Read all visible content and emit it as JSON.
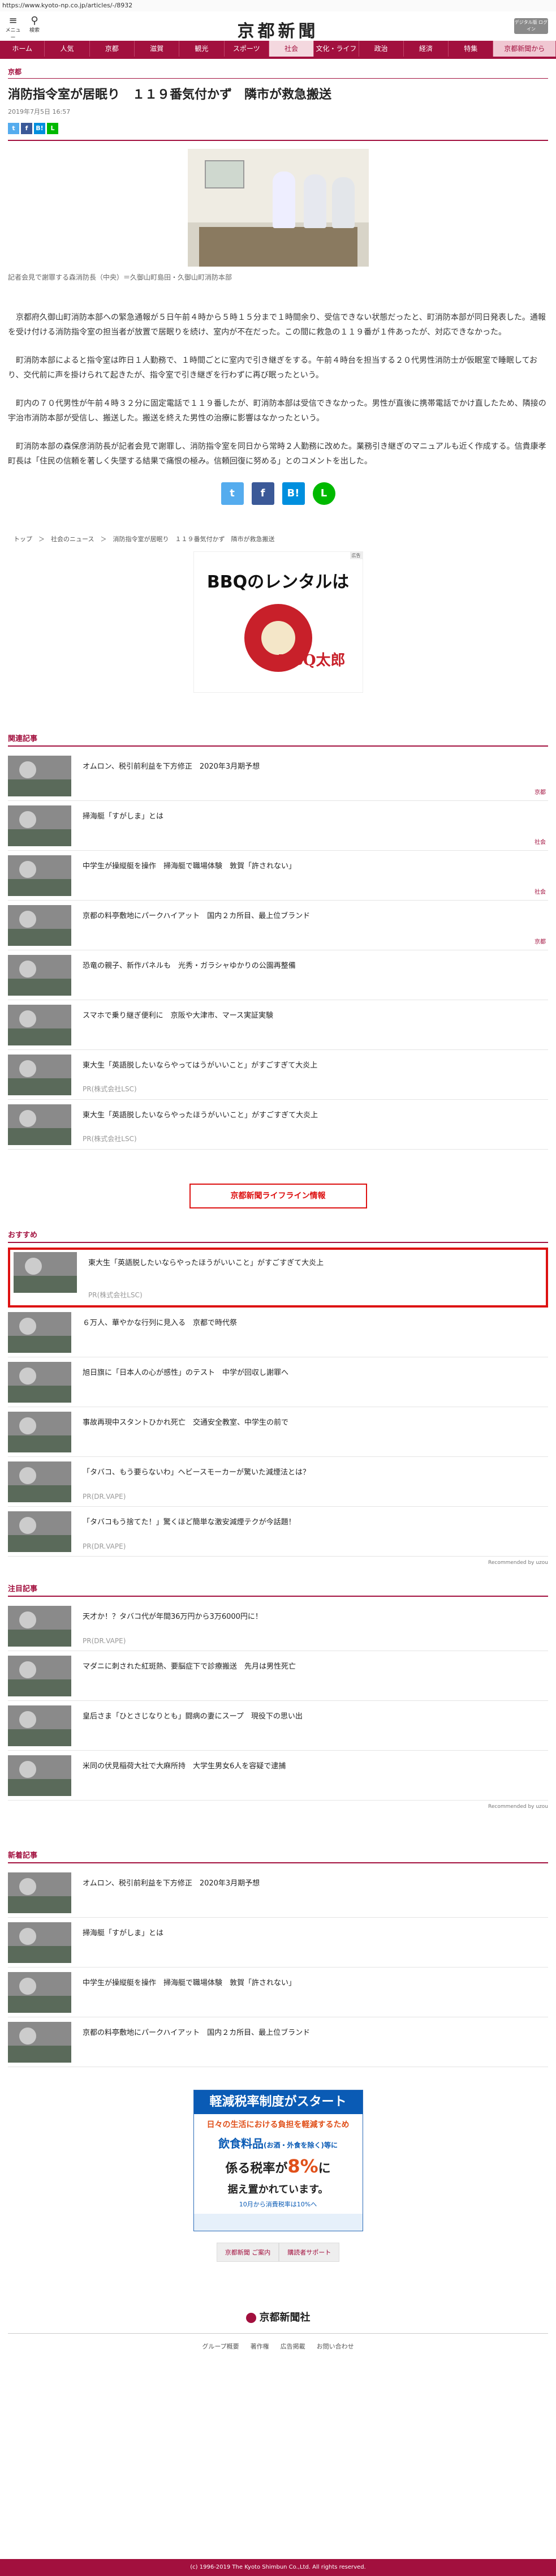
{
  "url": "https://www.kyoto-np.co.jp/articles/-/8932",
  "header": {
    "menu_icon": "≡",
    "menu_label": "メニュー",
    "search_icon": "⚲",
    "search_label": "検索",
    "logo": "京都新聞",
    "digital_label": "デジタル版 ログイン"
  },
  "nav": [
    "ホーム",
    "人気",
    "京都",
    "滋賀",
    "観光",
    "スポーツ",
    "社会",
    "文化・ライフ",
    "政治",
    "経済",
    "特集",
    "京都新聞から"
  ],
  "article": {
    "category": "京都",
    "title": "消防指令室が居眠り　１１９番気付かず　隣市が救急搬送",
    "date": "2019年7月5日 16:57",
    "share_small": [
      "t",
      "f",
      "B!",
      "L"
    ],
    "caption": "記者会見で謝罪する森消防長（中央）＝久御山町島田・久御山町消防本部",
    "paragraphs": [
      "京都府久御山町消防本部への緊急通報が５日午前４時から５時１５分まで１時間余り、受信できない状態だったと、町消防本部が同日発表した。通報を受け付ける消防指令室の担当者が放置で居眠りを続け、室内が不在だった。この間に救急の１１９番が１件あったが、対応できなかった。",
      "町消防本部によると指令室は昨日１人勤務で、１時間ごとに室内で引き継ぎをする。午前４時台を担当する２０代男性消防士が仮眠室で睡眠しており、交代前に声を掛けられて起きたが、指令室で引き継ぎを行わずに再び眠ったという。",
      "町内の７０代男性が午前４時３２分に固定電話で１１９番したが、町消防本部は受信できなかった。男性が直後に携帯電話でかけ直したため、隣接の宇治市消防本部が受信し、搬送した。搬送を終えた男性の治療に影響はなかったという。",
      "町消防本部の森保彦消防長が記者会見で謝罪し、消防指令室を同日から常時２人勤務に改めた。業務引き継ぎのマニュアルも近く作成する。信貴康孝町長は「住民の信頼を著しく失墜する結果で痛恨の極み。信頼回復に努める」とのコメントを出した。"
    ],
    "share_big": [
      "t",
      "f",
      "B!",
      "L"
    ],
    "breadcrumb": "トップ　＞　社会のニュース　＞　消防指令室が居眠り　１１９番気付かず　隣市が救急搬送"
  },
  "ad1": {
    "tag": "広告",
    "headline": "BBQのレンタルは",
    "brand": "BBQ太郎"
  },
  "related": {
    "title": "関連記事",
    "items": [
      {
        "title": "オムロン、税引前利益を下方修正　2020年3月期予想",
        "source": "",
        "tag": "京都"
      },
      {
        "title": "掃海艇「すがしま」とは",
        "source": "",
        "tag": "社会"
      },
      {
        "title": "中学生が操縦艇を操作　掃海艇で職場体験　敦賀「許されない」",
        "source": "",
        "tag": "社会"
      },
      {
        "title": "京都の料亭敷地にパークハイアット　国内２カ所目、最上位ブランド",
        "source": "",
        "tag": "京都"
      },
      {
        "title": "恐竜の親子、新作パネルも　光秀・ガラシャゆかりの公園再整備",
        "source": "",
        "tag": ""
      },
      {
        "title": "スマホで乗り継ぎ便利に　京阪や大津市、マース実証実験",
        "source": "",
        "tag": ""
      },
      {
        "title": "東大生「英語脱したいならやってはうがいいこと」がすごすぎて大炎上",
        "source": "PR(株式会社LSC)",
        "tag": ""
      },
      {
        "title": "東大生「英語脱したいならやったほうがいいこと」がすごすぎて大炎上",
        "source": "PR(株式会社LSC)",
        "tag": ""
      }
    ],
    "lifeline": "京都新聞ライフライン情報"
  },
  "recommended": {
    "title": "おすすめ",
    "items": [
      {
        "title": "東大生「英語脱したいならやったほうがいいこと」がすごすぎて大炎上",
        "source": "PR(株式会社LSC)"
      },
      {
        "title": "６万人、華やかな行列に見入る　京都で時代祭",
        "source": ""
      },
      {
        "title": "旭日旗に「日本人の心が感性」のテスト　中学が回収し謝罪へ",
        "source": ""
      },
      {
        "title": "事故再現中スタントひかれ死亡　交通安全教室、中学生の前で",
        "source": ""
      },
      {
        "title": "「タバコ、もう要らないわ」ヘビースモーカーが驚いた減煙法とは？",
        "source": "PR(DR.VAPE)"
      },
      {
        "title": "「タバコもう捨てた！」驚くほど簡単な激安減煙テクが今話題！",
        "source": "PR(DR.VAPE)"
      }
    ],
    "footer": "Recommended by uzou"
  },
  "featured": {
    "title": "注目記事",
    "items": [
      {
        "title": "天才か！？タバコ代が年間36万円から3万6000円に！",
        "source": "PR(DR.VAPE)"
      },
      {
        "title": "マダニに刺された紅斑熱、要脳症下で診療搬送　先月は男性死亡",
        "source": ""
      },
      {
        "title": "皇后さま「ひとさじなりとも」闘病の妻にスープ　現役下の思い出",
        "source": ""
      },
      {
        "title": "米同の伏見稲荷大社で大麻所持　大学生男女6人を容疑で逮捕",
        "source": ""
      }
    ],
    "footer": "Recommended by uzou"
  },
  "latest": {
    "title": "新着記事",
    "items": [
      {
        "title": "オムロン、税引前利益を下方修正　2020年3月期予想",
        "source": ""
      },
      {
        "title": "掃海艇「すがしま」とは",
        "source": ""
      },
      {
        "title": "中学生が操縦艇を操作　掃海艇で職場体験　敦賀「許されない」",
        "source": ""
      },
      {
        "title": "京都の料亭敷地にパークハイアット　国内２カ所目、最上位ブランド",
        "source": ""
      }
    ]
  },
  "ad2": {
    "band": "軽減税率制度がスタート",
    "line1": "日々の生活における負担を軽減するため",
    "line2": "飲食料品",
    "line2b": "(お酒・外食を除く)等に",
    "line3a": "係る税率が",
    "rate": "8%",
    "line3b": "に",
    "line3c": "据え置かれています。",
    "line4": "10月から消費税率は10%へ"
  },
  "footer": {
    "buttons": [
      "京都新聞 ご案内",
      "購読者サポート"
    ],
    "logo": "京都新聞社",
    "links": [
      "グループ概要",
      "著作権",
      "広告掲載",
      "お問い合わせ"
    ],
    "copyright": "(c) 1996-2019 The Kyoto Shimbun Co.,Ltd. All rights reserved."
  }
}
